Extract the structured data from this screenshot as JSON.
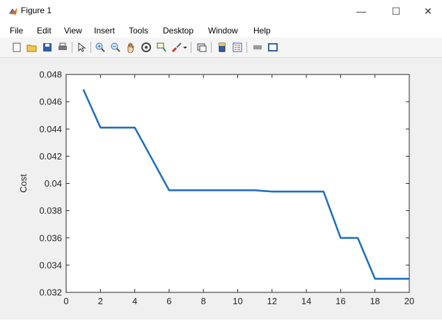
{
  "window": {
    "title": "Figure 1",
    "minimize_glyph": "—",
    "maximize_glyph": "☐",
    "close_glyph": "✕"
  },
  "menu": [
    "File",
    "Edit",
    "View",
    "Insert",
    "Tools",
    "Desktop",
    "Window",
    "Help"
  ],
  "toolbar": {
    "icons": [
      "new-figure-icon",
      "open-file-icon",
      "save-icon",
      "print-icon",
      "edit-plot-arrow-icon",
      "zoom-in-icon",
      "zoom-out-icon",
      "pan-hand-icon",
      "rotate-3d-icon",
      "data-cursor-icon",
      "brush-icon",
      "brush-dropdown-icon",
      "link-plot-icon",
      "insert-colorbar-icon",
      "insert-legend-icon",
      "hide-plot-tools-icon",
      "show-plot-tools-icon"
    ]
  },
  "colors": {
    "line": "#1f6fbf",
    "axes_bg": "#ffffff",
    "figure_bg": "#f0f0f0"
  },
  "chart_data": {
    "type": "line",
    "title": "",
    "xlabel": "",
    "ylabel": "Cost",
    "xlim": [
      0,
      20
    ],
    "ylim": [
      0.032,
      0.048
    ],
    "xticks": [
      0,
      2,
      4,
      6,
      8,
      10,
      12,
      14,
      16,
      18,
      20
    ],
    "yticks": [
      0.032,
      0.034,
      0.036,
      0.038,
      0.04,
      0.042,
      0.044,
      0.046,
      0.048
    ],
    "ytick_labels": [
      "0.032",
      "0.034",
      "0.036",
      "0.038",
      "0.04",
      "0.042",
      "0.044",
      "0.046",
      "0.048"
    ],
    "grid": false,
    "series": [
      {
        "x": [
          1,
          2,
          3,
          4,
          5,
          6,
          7,
          8,
          9,
          10,
          11,
          12,
          13,
          14,
          15,
          16,
          17,
          18,
          19,
          20
        ],
        "values": [
          0.0469,
          0.0441,
          0.0441,
          0.0441,
          0.0418,
          0.0395,
          0.0395,
          0.0395,
          0.0395,
          0.0395,
          0.0395,
          0.0394,
          0.0394,
          0.0394,
          0.0394,
          0.036,
          0.036,
          0.033,
          0.033,
          0.033
        ]
      }
    ]
  }
}
